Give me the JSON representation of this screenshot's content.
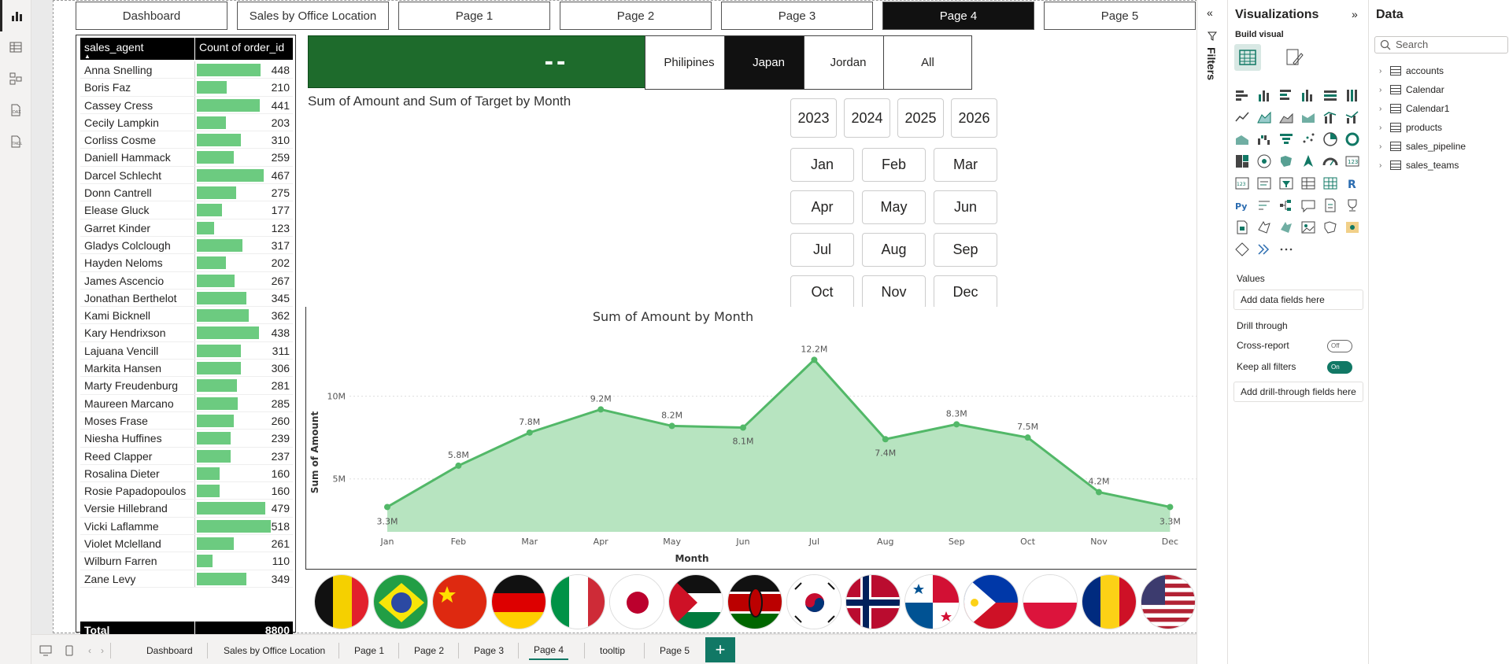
{
  "rail": {
    "icons": [
      "report-view-icon",
      "table-view-icon",
      "model-view-icon",
      "dax-query-icon",
      "tmdl-view-icon"
    ]
  },
  "nav": {
    "buttons": [
      {
        "label": "Dashboard"
      },
      {
        "label": "Sales by Office Location"
      },
      {
        "label": "Page 1"
      },
      {
        "label": "Page 2"
      },
      {
        "label": "Page 3"
      },
      {
        "label": "Page 4"
      },
      {
        "label": "Page 5"
      }
    ],
    "active": "Page 4"
  },
  "agent_table": {
    "col1": "sales_agent",
    "col2": "Count of order_id",
    "rows": [
      {
        "name": "Anna Snelling",
        "count": "448",
        "v": 448
      },
      {
        "name": "Boris Faz",
        "count": "210",
        "v": 210
      },
      {
        "name": "Cassey Cress",
        "count": "441",
        "v": 441
      },
      {
        "name": "Cecily Lampkin",
        "count": "203",
        "v": 203
      },
      {
        "name": "Corliss Cosme",
        "count": "310",
        "v": 310
      },
      {
        "name": "Daniell Hammack",
        "count": "259",
        "v": 259
      },
      {
        "name": "Darcel Schlecht",
        "count": "467",
        "v": 467
      },
      {
        "name": "Donn Cantrell",
        "count": "275",
        "v": 275
      },
      {
        "name": "Elease Gluck",
        "count": "177",
        "v": 177
      },
      {
        "name": "Garret Kinder",
        "count": "123",
        "v": 123
      },
      {
        "name": "Gladys Colclough",
        "count": "317",
        "v": 317
      },
      {
        "name": "Hayden Neloms",
        "count": "202",
        "v": 202
      },
      {
        "name": "James Ascencio",
        "count": "267",
        "v": 267
      },
      {
        "name": "Jonathan Berthelot",
        "count": "345",
        "v": 345
      },
      {
        "name": "Kami Bicknell",
        "count": "362",
        "v": 362
      },
      {
        "name": "Kary Hendrixson",
        "count": "438",
        "v": 438
      },
      {
        "name": "Lajuana Vencill",
        "count": "311",
        "v": 311
      },
      {
        "name": "Markita Hansen",
        "count": "306",
        "v": 306
      },
      {
        "name": "Marty Freudenburg",
        "count": "281",
        "v": 281
      },
      {
        "name": "Maureen Marcano",
        "count": "285",
        "v": 285
      },
      {
        "name": "Moses Frase",
        "count": "260",
        "v": 260
      },
      {
        "name": "Niesha Huffines",
        "count": "239",
        "v": 239
      },
      {
        "name": "Reed Clapper",
        "count": "237",
        "v": 237
      },
      {
        "name": "Rosalina Dieter",
        "count": "160",
        "v": 160
      },
      {
        "name": "Rosie Papadopoulos",
        "count": "160",
        "v": 160
      },
      {
        "name": "Versie Hillebrand",
        "count": "479",
        "v": 479
      },
      {
        "name": "Vicki Laflamme",
        "count": "518",
        "v": 518
      },
      {
        "name": "Violet Mclelland",
        "count": "261",
        "v": 261
      },
      {
        "name": "Wilburn Farren",
        "count": "110",
        "v": 110
      },
      {
        "name": "Zane Levy",
        "count": "349",
        "v": 349
      }
    ],
    "total_label": "Total",
    "total_value": "8800"
  },
  "kpi": {
    "value": "--",
    "color": "#1e6b2c"
  },
  "countries": {
    "buttons": [
      "Philipines",
      "Japan",
      "Jordan",
      "All"
    ],
    "active": "Japan"
  },
  "chart1": {
    "title": "Sum of Amount and Sum of Target by Month"
  },
  "years": [
    "2023",
    "2024",
    "2025",
    "2026"
  ],
  "months": [
    "Jan",
    "Feb",
    "Mar",
    "Apr",
    "May",
    "Jun",
    "Jul",
    "Aug",
    "Sep",
    "Oct",
    "Nov",
    "Dec"
  ],
  "chart_data": {
    "type": "area",
    "title": "Sum of Amount by Month",
    "xlabel": "Month",
    "ylabel": "Sum of Amount",
    "categories": [
      "Jan",
      "Feb",
      "Mar",
      "Apr",
      "May",
      "Jun",
      "Jul",
      "Aug",
      "Sep",
      "Oct",
      "Nov",
      "Dec"
    ],
    "values": [
      3.3,
      5.8,
      7.8,
      9.2,
      8.2,
      8.1,
      12.2,
      7.4,
      8.3,
      7.5,
      4.2,
      3.3
    ],
    "labels": [
      "3.3M",
      "5.8M",
      "7.8M",
      "9.2M",
      "8.2M",
      "8.1M",
      "12.2M",
      "7.4M",
      "8.3M",
      "7.5M",
      "4.2M",
      "3.3M"
    ],
    "yticks": [
      "5M",
      "10M"
    ],
    "ylim": [
      1.8,
      13.5
    ],
    "grid": true,
    "color": "#52b868"
  },
  "flags": [
    "belgium",
    "brazil",
    "china",
    "germany",
    "italy",
    "japan",
    "jordan",
    "kenya",
    "south-korea",
    "norway",
    "panama",
    "philippines",
    "poland",
    "romania",
    "usa"
  ],
  "tabs": {
    "items": [
      "Dashboard",
      "Sales by Office Location",
      "Page 1",
      "Page 2",
      "Page 3",
      "Page 4",
      "tooltip",
      "Page 5"
    ],
    "active": "Page 4",
    "add": "+"
  },
  "filters": {
    "label": "Filters"
  },
  "viz": {
    "title": "Visualizations",
    "build": "Build visual",
    "values": "Values",
    "values_well": "Add data fields here",
    "drill": "Drill through",
    "cross_report": "Cross-report",
    "cross_state": "Off",
    "keep_filters": "Keep all filters",
    "keep_state": "On",
    "drill_well": "Add drill-through fields here"
  },
  "data_pane": {
    "title": "Data",
    "search_placeholder": "Search",
    "tables": [
      "accounts",
      "Calendar",
      "Calendar1",
      "products",
      "sales_pipeline",
      "sales_teams"
    ]
  }
}
